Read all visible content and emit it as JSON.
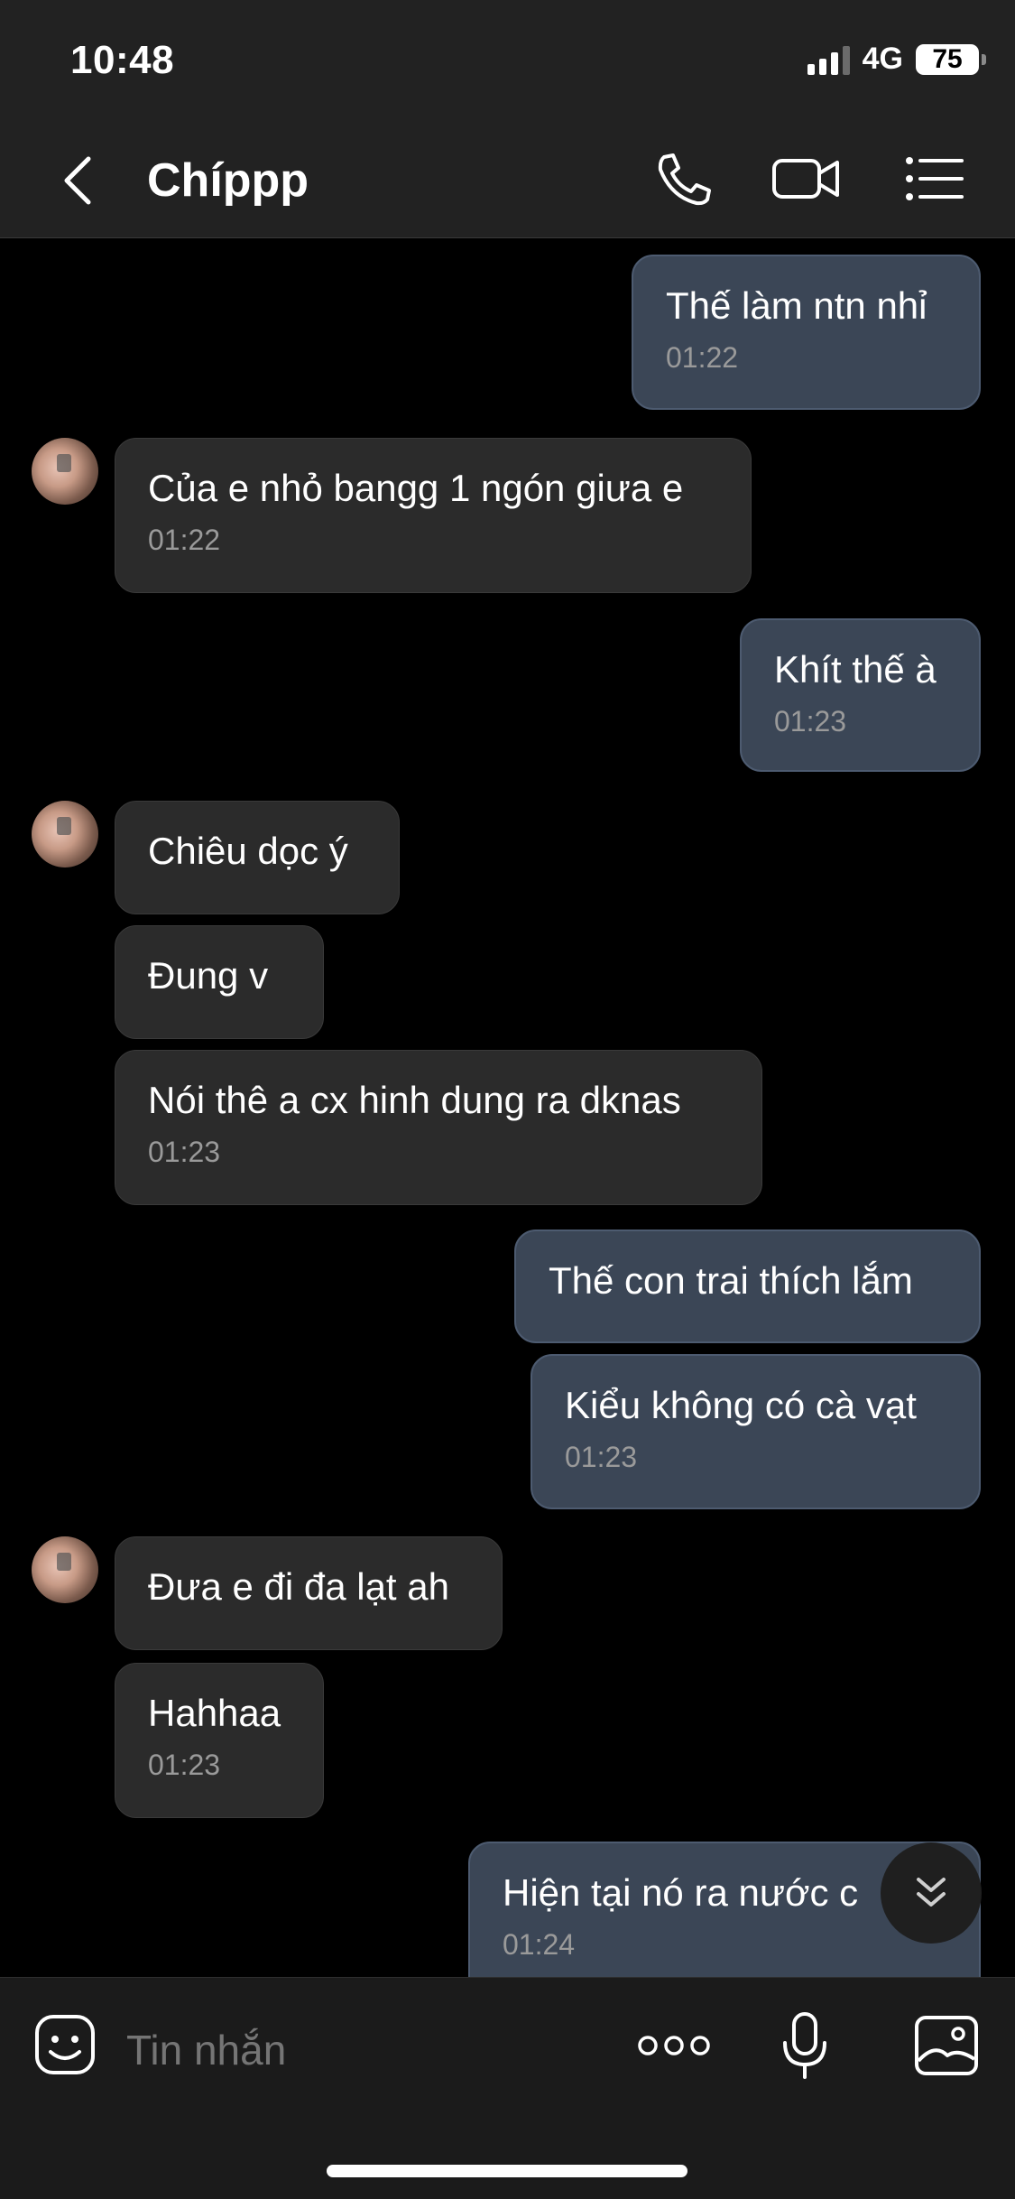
{
  "status_bar": {
    "time": "10:48",
    "network": "4G",
    "battery": "75"
  },
  "header": {
    "contact_name": "Chíppp"
  },
  "messages": [
    {
      "side": "out",
      "text": "Thế làm ntn nhỉ",
      "time": "01:22"
    },
    {
      "side": "in",
      "text": "Của e nhỏ bangg 1 ngón giưa e",
      "time": "01:22"
    },
    {
      "side": "out",
      "text": "Khít thế à",
      "time": "01:23"
    },
    {
      "side": "in",
      "text": "Chiêu dọc ý",
      "time": ""
    },
    {
      "side": "in",
      "text": "Đung v",
      "time": ""
    },
    {
      "side": "in",
      "text": "Nói thê a cx hinh dung ra dknas",
      "time": "01:23"
    },
    {
      "side": "out",
      "text": "Thế con trai thích lắm",
      "time": ""
    },
    {
      "side": "out",
      "text": "Kiểu không có cà vạt",
      "time": "01:23"
    },
    {
      "side": "in",
      "text": "Đưa e đi đa lạt ah",
      "time": ""
    },
    {
      "side": "in",
      "text": "Hahhaa",
      "time": "01:23"
    },
    {
      "side": "out",
      "text": "Hiện tại nó ra nước c",
      "time": "01:24"
    }
  ],
  "composer": {
    "placeholder": "Tin nhắn"
  },
  "colors": {
    "incoming_bubble": "#2b2b2b",
    "outgoing_bubble": "#3b4656",
    "header_bg": "#222222"
  },
  "icons": [
    "chevron-left-icon",
    "phone-icon",
    "video-camera-icon",
    "list-menu-icon",
    "chevron-double-down-icon",
    "emoji-sticker-icon",
    "more-dots-icon",
    "microphone-icon",
    "image-gallery-icon"
  ]
}
